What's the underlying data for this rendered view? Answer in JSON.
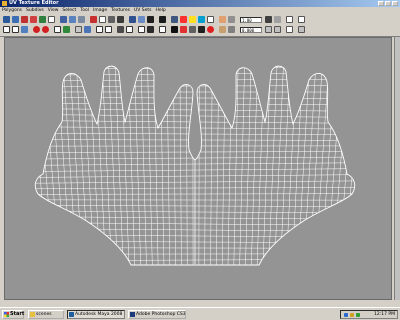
{
  "window": {
    "title": "UV Texture Editor"
  },
  "menu": [
    "Polygons",
    "Subdivs",
    "View",
    "Select",
    "Tool",
    "Image",
    "Textures",
    "UV Sets",
    "Help"
  ],
  "toolbar": {
    "field_u": "1.00",
    "field_v": "0.000"
  },
  "taskbar": {
    "start_label": "Start",
    "tasks": [
      {
        "label": "scenes"
      },
      {
        "label": "Autodesk Maya 2008"
      },
      {
        "label": "Adobe Photoshop CS3"
      }
    ],
    "clock": "12:17 PM"
  }
}
